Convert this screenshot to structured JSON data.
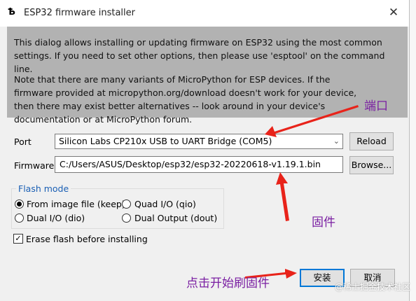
{
  "window": {
    "title": "ESP32 firmware installer",
    "icon": "snake-tool-icon",
    "close_glyph": "✕"
  },
  "info": {
    "paragraph1": "This dialog allows installing or updating firmware on ESP32 using the most common settings. If you need to set other options, then please use 'esptool' on the command line.",
    "paragraph2": "Note that there are many variants of MicroPython for ESP devices. If the firmware provided at micropython.org/download doesn't work for your device, then there may exist better alternatives -- look around in your device's documentation or at MicroPython forum."
  },
  "port": {
    "label": "Port",
    "value": "Silicon Labs CP210x USB to UART Bridge (COM5)",
    "reload": "Reload"
  },
  "firmware": {
    "label": "Firmware",
    "value": "C:/Users/ASUS/Desktop/esp32/esp32-20220618-v1.19.1.bin",
    "browse": "Browse..."
  },
  "flash_mode": {
    "legend": "Flash mode",
    "options": [
      {
        "label": "From image file (keep)",
        "selected": true
      },
      {
        "label": "Quad I/O (qio)",
        "selected": false
      },
      {
        "label": "Dual I/O (dio)",
        "selected": false
      },
      {
        "label": "Dual Output (dout)",
        "selected": false
      }
    ]
  },
  "erase": {
    "label": "Erase flash before installing",
    "checked": true
  },
  "buttons": {
    "install": "安装",
    "cancel": "取消"
  },
  "annotations": {
    "port_note": "端口",
    "firmware_note": "固件",
    "install_note": "点击开始刷固件"
  },
  "colors": {
    "arrow": "#e8231a",
    "annotation_text": "#7a1fa2",
    "info_bg": "#b2b2b2"
  },
  "watermark": "@稀土掘金技术社区"
}
